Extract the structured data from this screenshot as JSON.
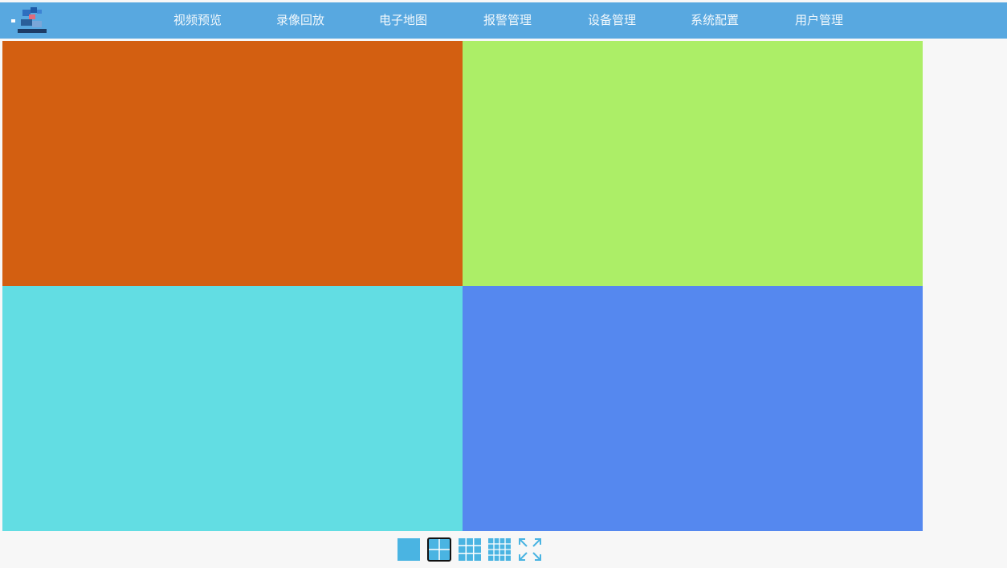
{
  "header": {
    "logo": "app-logo",
    "nav_items": [
      "视频预览",
      "录像回放",
      "电子地图",
      "报警管理",
      "设备管理",
      "系统配置",
      "用户管理"
    ]
  },
  "video_grid": {
    "layout": "2x2",
    "cells": [
      {
        "color": "#d35f11"
      },
      {
        "color": "#acee67"
      },
      {
        "color": "#62dde3"
      },
      {
        "color": "#5588ef"
      }
    ]
  },
  "layout_toolbar": {
    "buttons": [
      {
        "icon": "single-view-icon",
        "selected": false
      },
      {
        "icon": "quad-view-icon",
        "selected": true
      },
      {
        "icon": "nine-view-icon",
        "selected": false
      },
      {
        "icon": "sixteen-view-icon",
        "selected": false
      },
      {
        "icon": "fullscreen-icon",
        "selected": false
      }
    ]
  },
  "colors": {
    "header_bg": "#58a8e0",
    "toolbar_accent": "#4ab4e2",
    "page_bg": "#f7f7f7"
  }
}
